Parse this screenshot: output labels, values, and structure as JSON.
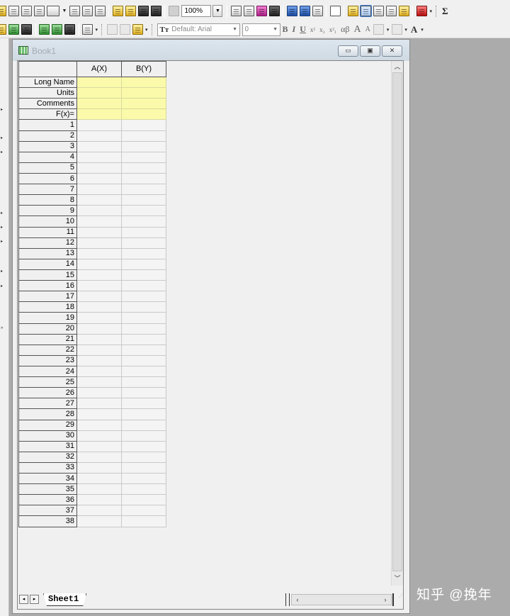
{
  "toolbar": {
    "zoom_value": "100%",
    "font_name": "Default: Arial",
    "font_size": "0",
    "sigma_label": "Σ",
    "format": {
      "bold": "B",
      "italic": "I",
      "underline": "U",
      "superscript": "x²",
      "subscript": "x₂",
      "sup_sub": "x²₁",
      "greek": "αβ",
      "increase_font": "A",
      "decrease_font": "A"
    }
  },
  "workbook": {
    "title": "Book1",
    "columns": [
      "A(X)",
      "B(Y)"
    ],
    "meta_rows": [
      "Long Name",
      "Units",
      "Comments",
      "F(x)="
    ],
    "rows": [
      "1",
      "2",
      "3",
      "4",
      "5",
      "6",
      "7",
      "8",
      "9",
      "10",
      "11",
      "12",
      "13",
      "14",
      "15",
      "16",
      "17",
      "18",
      "19",
      "20",
      "21",
      "22",
      "23",
      "24",
      "25",
      "26",
      "27",
      "28",
      "29",
      "30",
      "31",
      "32",
      "33",
      "34",
      "35",
      "36",
      "37",
      "38"
    ],
    "sheet_tab": "Sheet1"
  },
  "watermark": "知乎 @挽年",
  "colors": {
    "meta_cell": "#fafaaa",
    "workspace": "#ababab",
    "titlebar": "#d6dfe8"
  }
}
